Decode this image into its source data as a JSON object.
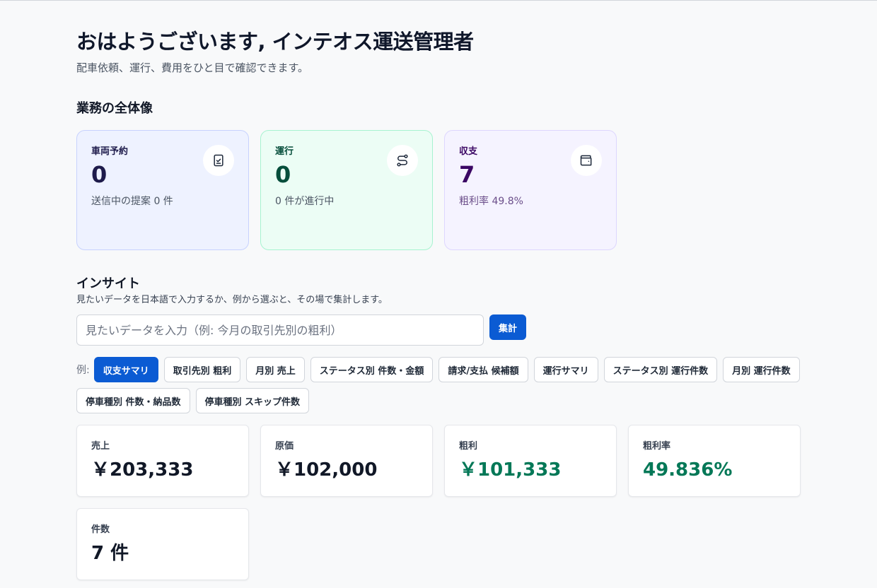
{
  "header": {
    "greeting": "おはようございます, インテオス運送管理者",
    "subtitle": "配車依頼、運行、費用をひと目で確認できます。"
  },
  "overview": {
    "title": "業務の全体像",
    "cards": [
      {
        "label": "車両予約",
        "value": "0",
        "note": "送信中の提案 0 件",
        "icon": "clipboard-check-icon"
      },
      {
        "label": "運行",
        "value": "0",
        "note": "0 件が進行中",
        "icon": "route-icon"
      },
      {
        "label": "収支",
        "value": "7",
        "note": "粗利率 49.8%",
        "icon": "wallet-icon"
      }
    ]
  },
  "insight": {
    "title": "インサイト",
    "description": "見たいデータを日本語で入力するか、例から選ぶと、その場で集計します。",
    "input_placeholder": "見たいデータを入力（例: 今月の取引先別の粗利）",
    "input_value": "",
    "submit_label": "集計",
    "examples_label": "例:",
    "examples": [
      {
        "label": "収支サマリ",
        "active": true
      },
      {
        "label": "取引先別 粗利",
        "active": false
      },
      {
        "label": "月別 売上",
        "active": false
      },
      {
        "label": "ステータス別 件数・金額",
        "active": false
      },
      {
        "label": "請求/支払 候補額",
        "active": false
      },
      {
        "label": "運行サマリ",
        "active": false
      },
      {
        "label": "ステータス別 運行件数",
        "active": false
      },
      {
        "label": "月別 運行件数",
        "active": false
      },
      {
        "label": "停車種別 件数・納品数",
        "active": false
      },
      {
        "label": "停車種別 スキップ件数",
        "active": false
      }
    ],
    "metrics": [
      {
        "label": "売上",
        "value": "￥203,333",
        "highlight": false
      },
      {
        "label": "原価",
        "value": "￥102,000",
        "highlight": false
      },
      {
        "label": "粗利",
        "value": "￥101,333",
        "highlight": true
      },
      {
        "label": "粗利率",
        "value": "49.836%",
        "highlight": true
      },
      {
        "label": "件数",
        "value": "7 件",
        "highlight": false
      }
    ]
  },
  "colors": {
    "accent": "#0b5bd3",
    "positive": "#047857",
    "card_blue": "#eef2ff",
    "card_green": "#ecfdf5",
    "card_purple": "#f5f3ff"
  }
}
